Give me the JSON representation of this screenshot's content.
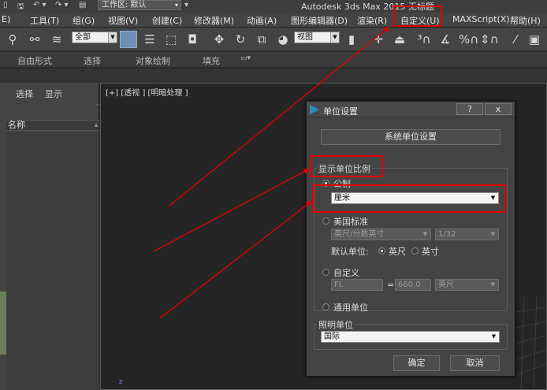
{
  "titlebar": {
    "workspace_label": "工作区: 默认",
    "app_title": "Autodesk 3ds Max  2015    无标题"
  },
  "menubar": {
    "items": [
      "E)",
      "工具(T)",
      "组(G)",
      "视图(V)",
      "创建(C)",
      "修改器(M)",
      "动画(A)",
      "图形编辑器(D)",
      "渲染(R)",
      "自定义(U)",
      "MAXScript(X)",
      "帮助(H)"
    ]
  },
  "toolbar": {
    "filter_combo": "全部",
    "refcoord_combo": "视图"
  },
  "ribbon": {
    "tabs": [
      "自由形式",
      "选择",
      "对象绘制",
      "填充"
    ]
  },
  "scene_explorer": {
    "tabs": [
      "选择",
      "显示"
    ],
    "name_header": "名称"
  },
  "viewport": {
    "label": "[+] [透视 ] [明暗处理 ]",
    "axis_label": "z"
  },
  "dialog": {
    "title": "单位设置",
    "help_button": "?",
    "close_button": "x",
    "system_units_button": "系统单位设置",
    "display_scale_group": "显示单位比例",
    "metric_label": "公制",
    "metric_value": "厘米",
    "us_standard_label": "美国标准",
    "us_unit_value": "英尺/分数英寸",
    "us_fraction_value": "1/32",
    "default_units_label": "默认单位:",
    "default_feet": "英尺",
    "default_inches": "英寸",
    "custom_label": "自定义",
    "custom_name": "FL",
    "custom_equals": "=",
    "custom_value": "660.0",
    "custom_unit": "英尺",
    "generic_label": "通用单位",
    "lighting_group": "照明单位",
    "lighting_value": "国际",
    "ok_button": "确定",
    "cancel_button": "取消"
  },
  "colors": {
    "highlight": "#e00000",
    "dialog_bg": "#444444",
    "viewport_bg": "#252525"
  }
}
